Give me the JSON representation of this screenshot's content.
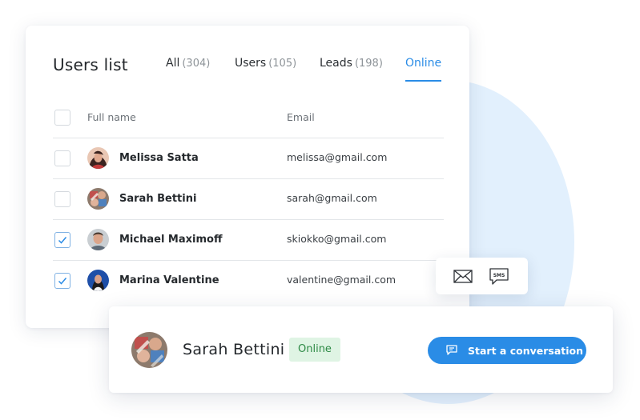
{
  "card": {
    "title": "Users list",
    "tabs": [
      {
        "label": "All",
        "count": "(304)"
      },
      {
        "label": "Users",
        "count": "(105)"
      },
      {
        "label": "Leads",
        "count": "(198)"
      },
      {
        "label": "Online",
        "active": true
      }
    ],
    "columns": {
      "name": "Full name",
      "email": "Email"
    },
    "rows": [
      {
        "name": "Melissa Satta",
        "email": "melissa@gmail.com",
        "checked": false,
        "avatar": "melissa-avatar"
      },
      {
        "name": "Sarah Bettini",
        "email": "sarah@gmail.com",
        "checked": false,
        "avatar": "sarah-avatar"
      },
      {
        "name": "Michael Maximoff",
        "email": "skiokko@gmail.com",
        "checked": true,
        "avatar": "michael-avatar"
      },
      {
        "name": "Marina Valentine",
        "email": "valentine@gmail.com",
        "checked": true,
        "avatar": "marina-avatar"
      }
    ]
  },
  "actions": {
    "icons": [
      "mail-icon",
      "sms-icon"
    ],
    "sms_text": "SMS"
  },
  "profile": {
    "name": "Sarah Bettini",
    "status": "Online",
    "button_label": "Start a conversation",
    "button_icon": "chat-icon"
  },
  "colors": {
    "accent": "#2a8ce6",
    "status_bg": "#dff4e4",
    "status_text": "#2d8a45",
    "bg_circle": "#e2f0fd"
  }
}
